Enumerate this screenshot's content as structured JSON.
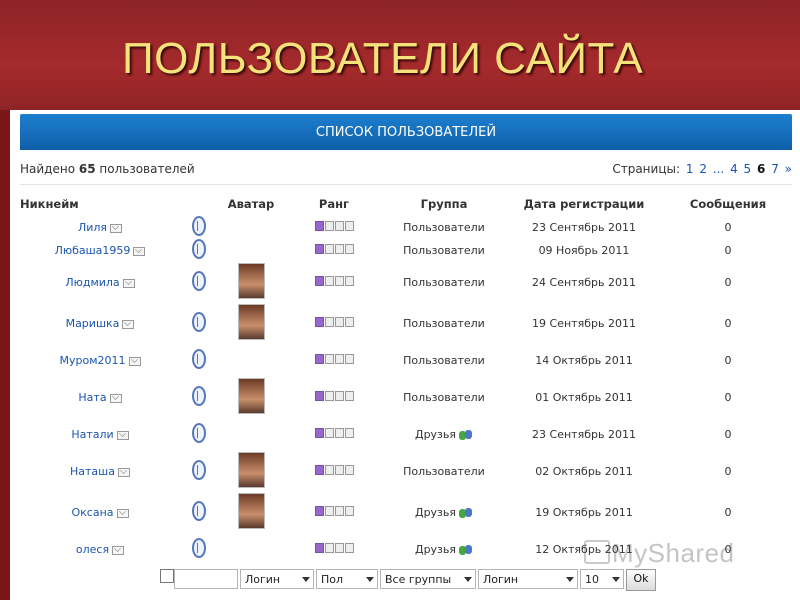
{
  "slide": {
    "title": "ПОЛЬЗОВАТЕЛИ САЙТА"
  },
  "panel": {
    "title": "СПИСОК ПОЛЬЗОВАТЕЛЕЙ",
    "found_prefix": "Найдено",
    "found_count": "65",
    "found_suffix": "пользователей",
    "pager": {
      "label": "Страницы:",
      "before": [
        "1",
        "2"
      ],
      "ellipsis": "...",
      "after": [
        "4",
        "5"
      ],
      "current": "6",
      "next": "7",
      "more": "»"
    }
  },
  "columns": {
    "nick": "Никнейм",
    "avatar": "Аватар",
    "rank": "Ранг",
    "group": "Группа",
    "date": "Дата регистрации",
    "messages": "Сообщения"
  },
  "users": [
    {
      "nick": "Лиля",
      "avatar": false,
      "rank": 1,
      "group": "Пользователи",
      "friends": false,
      "date": "23 Сентябрь 2011",
      "messages": "0"
    },
    {
      "nick": "Любаша1959",
      "avatar": false,
      "rank": 1,
      "group": "Пользователи",
      "friends": false,
      "date": "09 Ноябрь 2011",
      "messages": "0"
    },
    {
      "nick": "Людмила",
      "avatar": true,
      "rank": 1,
      "group": "Пользователи",
      "friends": false,
      "date": "24 Сентябрь 2011",
      "messages": "0"
    },
    {
      "nick": "Маришка",
      "avatar": true,
      "rank": 1,
      "group": "Пользователи",
      "friends": false,
      "date": "19 Сентябрь 2011",
      "messages": "0"
    },
    {
      "nick": "Муром2011",
      "avatar": false,
      "rank": 1,
      "group": "Пользователи",
      "friends": false,
      "date": "14 Октябрь 2011",
      "messages": "0"
    },
    {
      "nick": "Ната",
      "avatar": true,
      "rank": 1,
      "group": "Пользователи",
      "friends": false,
      "date": "01 Октябрь 2011",
      "messages": "0"
    },
    {
      "nick": "Натали",
      "avatar": false,
      "rank": 1,
      "group": "Друзья",
      "friends": true,
      "date": "23 Сентябрь 2011",
      "messages": "0"
    },
    {
      "nick": "Наташа",
      "avatar": true,
      "rank": 1,
      "group": "Пользователи",
      "friends": false,
      "date": "02 Октябрь 2011",
      "messages": "0"
    },
    {
      "nick": "Оксана",
      "avatar": true,
      "rank": 1,
      "group": "Друзья",
      "friends": true,
      "date": "19 Октябрь 2011",
      "messages": "0"
    },
    {
      "nick": "олеся",
      "avatar": false,
      "rank": 1,
      "group": "Друзья",
      "friends": true,
      "date": "12 Октябрь 2011",
      "messages": "0"
    }
  ],
  "filters": {
    "search_value": "",
    "sort_field": "Логин",
    "gender": "Пол",
    "group": "Все группы",
    "order_field": "Логин",
    "per_page": "10",
    "ok_label": "Ok"
  },
  "watermark": {
    "text": "MyShared"
  },
  "colors": {
    "header_red": "#a52a2c",
    "title_yellow": "#f4e27a",
    "panel_blue": "#1670c0",
    "link_blue": "#1a55b0",
    "rank_purple": "#9966cc"
  }
}
